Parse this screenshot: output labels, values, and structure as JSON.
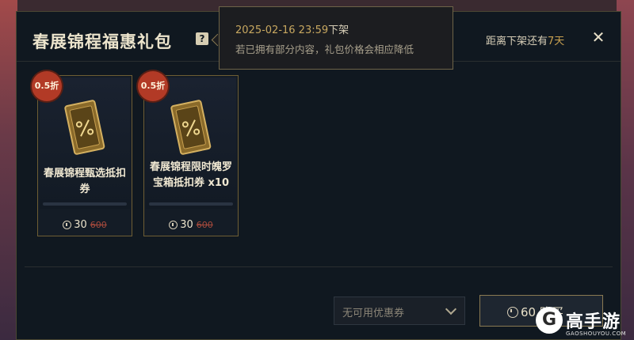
{
  "dialog": {
    "title": "春展锦程福惠礼包",
    "help_glyph": "?",
    "countdown_prefix": "距离下架还有",
    "countdown_days": "7天",
    "close_glyph": "✕"
  },
  "tooltip": {
    "datetime": "2025-02-16 23:59",
    "datetime_suffix": "下架",
    "note": "若已拥有部分内容，礼包价格会相应降低"
  },
  "items": [
    {
      "badge": "0.5折",
      "name": "春展锦程甄选抵扣券",
      "price": "30",
      "original_price": "600",
      "icon": "discount-ticket-icon"
    },
    {
      "badge": "0.5折",
      "name": "春展锦程限时魄罗宝箱抵扣券 x10",
      "price": "30",
      "original_price": "600",
      "icon": "discount-ticket-icon"
    }
  ],
  "footer": {
    "coupon_select": "无可用优惠券",
    "buy_price": "60",
    "buy_label": "购买"
  },
  "watermark": {
    "logo": "G",
    "text": "高手游",
    "url": "GAOSHOUYOU.COM"
  },
  "colors": {
    "accent_gold": "#c8a050",
    "badge_red": "#b23a26",
    "panel_bg": "#101820"
  }
}
